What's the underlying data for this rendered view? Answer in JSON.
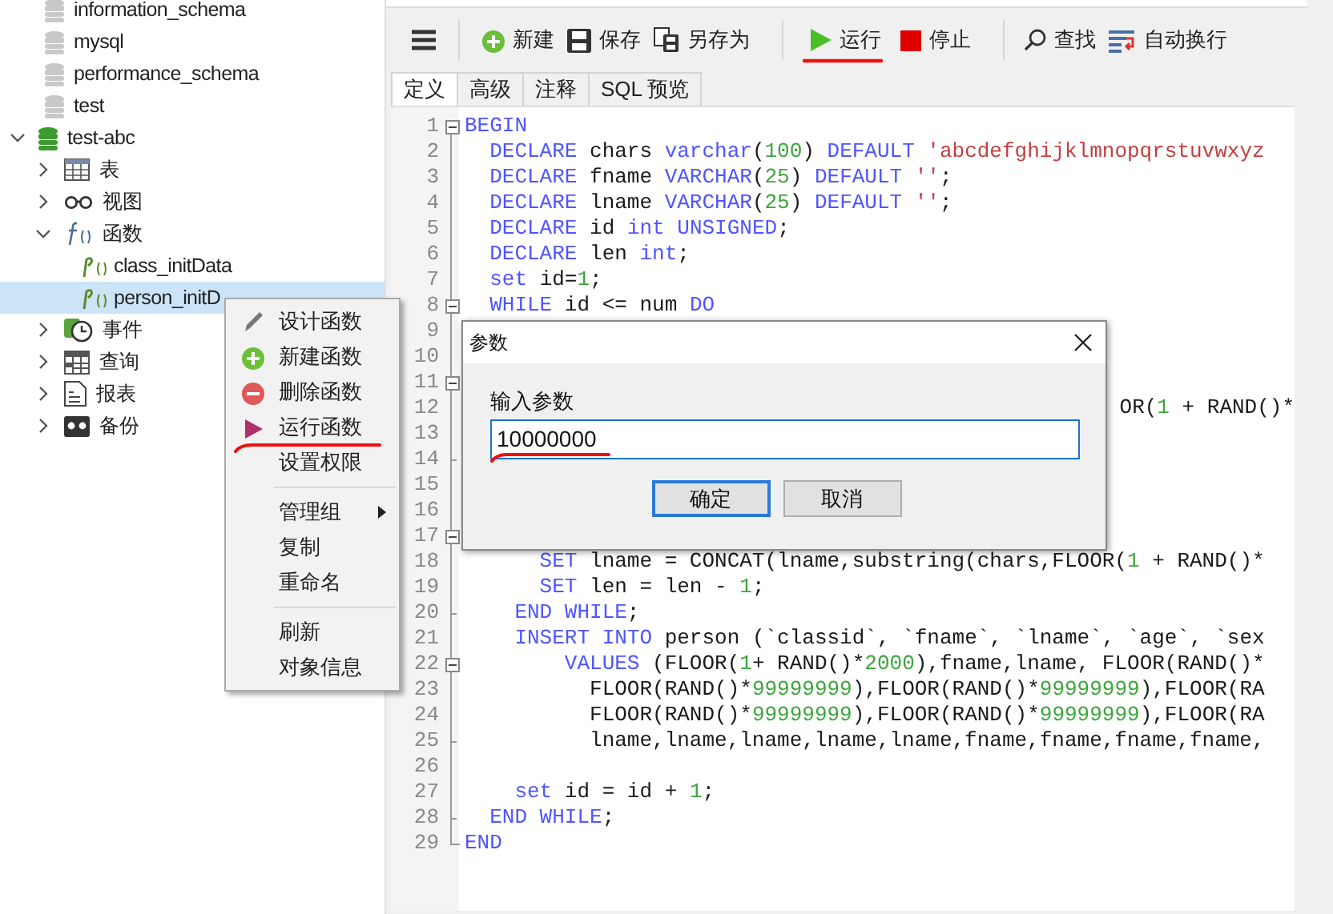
{
  "tree": [
    {
      "label": "information_schema",
      "kind": "db",
      "connected": false,
      "selected": false
    },
    {
      "label": "mysql",
      "kind": "db",
      "connected": false,
      "selected": false
    },
    {
      "label": "performance_schema",
      "kind": "db",
      "connected": false,
      "selected": false
    },
    {
      "label": "test",
      "kind": "db",
      "connected": false,
      "selected": false
    },
    {
      "label": "test-abc",
      "kind": "db",
      "connected": true,
      "expanded": true,
      "selected": false,
      "children": [
        {
          "label": "表",
          "kind": "tables",
          "expanded": false,
          "selected": false
        },
        {
          "label": "视图",
          "kind": "views",
          "expanded": false,
          "selected": false
        },
        {
          "label": "函数",
          "kind": "functions",
          "expanded": true,
          "selected": false,
          "children": [
            {
              "label": "class_initData",
              "kind": "function",
              "selected": false
            },
            {
              "label": "person_initD",
              "kind": "function",
              "selected": true
            }
          ]
        },
        {
          "label": "事件",
          "kind": "events",
          "expanded": false,
          "selected": false
        },
        {
          "label": "查询",
          "kind": "queries",
          "expanded": false,
          "selected": false
        },
        {
          "label": "报表",
          "kind": "reports",
          "expanded": false,
          "selected": false
        },
        {
          "label": "备份",
          "kind": "backups",
          "expanded": false,
          "selected": false
        }
      ]
    }
  ],
  "toolbar": [
    {
      "kind": "menu"
    },
    {
      "kind": "separator"
    },
    {
      "kind": "new",
      "label": "新建"
    },
    {
      "kind": "save",
      "label": "保存"
    },
    {
      "kind": "saveas",
      "label": "另存为"
    },
    {
      "kind": "separator"
    },
    {
      "kind": "run",
      "label": "运行",
      "highlighted": true
    },
    {
      "kind": "stop",
      "label": "停止"
    },
    {
      "kind": "separator"
    },
    {
      "kind": "find",
      "label": "查找"
    },
    {
      "kind": "wrap",
      "label": "自动换行"
    }
  ],
  "tabs": [
    {
      "label": "定义",
      "selected": true
    },
    {
      "label": "高级",
      "selected": false
    },
    {
      "label": "注释",
      "selected": false
    },
    {
      "label": "SQL 预览",
      "selected": false
    }
  ],
  "code_lines": [
    {
      "number": "1",
      "fold_start": true,
      "segments": [
        {
          "kind": "keyword",
          "text": "BEGIN"
        }
      ]
    },
    {
      "number": "2",
      "segments": [
        {
          "kind": "keyword",
          "text": "  DECLARE"
        },
        {
          "kind": "plain",
          "text": " chars "
        },
        {
          "kind": "keyword",
          "text": "varchar"
        },
        {
          "kind": "plain",
          "text": "("
        },
        {
          "kind": "number",
          "text": "100"
        },
        {
          "kind": "plain",
          "text": ") "
        },
        {
          "kind": "keyword",
          "text": "DEFAULT"
        },
        {
          "kind": "string",
          "text": " 'abcdefghijklmnopqrstuvwxyz"
        }
      ]
    },
    {
      "number": "3",
      "segments": [
        {
          "kind": "keyword",
          "text": "  DECLARE"
        },
        {
          "kind": "plain",
          "text": " fname "
        },
        {
          "kind": "keyword",
          "text": "VARCHAR"
        },
        {
          "kind": "plain",
          "text": "("
        },
        {
          "kind": "number",
          "text": "25"
        },
        {
          "kind": "plain",
          "text": ") "
        },
        {
          "kind": "keyword",
          "text": "DEFAULT"
        },
        {
          "kind": "string",
          "text": " ''"
        },
        {
          "kind": "plain",
          "text": ";"
        }
      ]
    },
    {
      "number": "4",
      "segments": [
        {
          "kind": "keyword",
          "text": "  DECLARE"
        },
        {
          "kind": "plain",
          "text": " lname "
        },
        {
          "kind": "keyword",
          "text": "VARCHAR"
        },
        {
          "kind": "plain",
          "text": "("
        },
        {
          "kind": "number",
          "text": "25"
        },
        {
          "kind": "plain",
          "text": ") "
        },
        {
          "kind": "keyword",
          "text": "DEFAULT"
        },
        {
          "kind": "string",
          "text": " ''"
        },
        {
          "kind": "plain",
          "text": ";"
        }
      ]
    },
    {
      "number": "5",
      "segments": [
        {
          "kind": "keyword",
          "text": "  DECLARE"
        },
        {
          "kind": "plain",
          "text": " id "
        },
        {
          "kind": "keyword",
          "text": "int UNSIGNED"
        },
        {
          "kind": "plain",
          "text": ";"
        }
      ]
    },
    {
      "number": "6",
      "segments": [
        {
          "kind": "keyword",
          "text": "  DECLARE"
        },
        {
          "kind": "plain",
          "text": " len "
        },
        {
          "kind": "keyword",
          "text": "int"
        },
        {
          "kind": "plain",
          "text": ";"
        }
      ]
    },
    {
      "number": "7",
      "segments": [
        {
          "kind": "keyword",
          "text": "  set"
        },
        {
          "kind": "plain",
          "text": " id="
        },
        {
          "kind": "number",
          "text": "1"
        },
        {
          "kind": "plain",
          "text": ";"
        }
      ]
    },
    {
      "number": "8",
      "fold_start": true,
      "segments": [
        {
          "kind": "keyword",
          "text": "  WHILE"
        },
        {
          "kind": "plain",
          "text": " id <= num "
        },
        {
          "kind": "keyword",
          "text": "DO"
        }
      ]
    },
    {
      "number": "9"
    },
    {
      "number": "10"
    },
    {
      "number": "11",
      "fold_start": true
    },
    {
      "number": "12",
      "cut_left": true,
      "segments": [
        {
          "kind": "plain",
          "text": "OR("
        },
        {
          "kind": "number",
          "text": "1"
        },
        {
          "kind": "plain",
          "text": " + RAND()*"
        }
      ]
    },
    {
      "number": "13"
    },
    {
      "number": "14",
      "fold_end": true
    },
    {
      "number": "15"
    },
    {
      "number": "16"
    },
    {
      "number": "17",
      "fold_start": true
    },
    {
      "number": "18",
      "segments": [
        {
          "kind": "keyword",
          "text": "      SET"
        },
        {
          "kind": "plain",
          "text": " lname = CONCAT(lname,substring(chars,FLOOR("
        },
        {
          "kind": "number",
          "text": "1"
        },
        {
          "kind": "plain",
          "text": " + RAND()*"
        }
      ]
    },
    {
      "number": "19",
      "segments": [
        {
          "kind": "keyword",
          "text": "      SET"
        },
        {
          "kind": "plain",
          "text": " len = len - "
        },
        {
          "kind": "number",
          "text": "1"
        },
        {
          "kind": "plain",
          "text": ";"
        }
      ]
    },
    {
      "number": "20",
      "fold_end": true,
      "segments": [
        {
          "kind": "keyword",
          "text": "    END WHILE"
        },
        {
          "kind": "plain",
          "text": ";"
        }
      ]
    },
    {
      "number": "21",
      "segments": [
        {
          "kind": "keyword",
          "text": "    INSERT INTO"
        },
        {
          "kind": "plain",
          "text": " person (`classid`, `fname`, `lname`, `age`, `sex"
        }
      ]
    },
    {
      "number": "22",
      "fold_start": true,
      "segments": [
        {
          "kind": "keyword",
          "text": "        VALUES"
        },
        {
          "kind": "plain",
          "text": " (FLOOR("
        },
        {
          "kind": "number",
          "text": "1"
        },
        {
          "kind": "plain",
          "text": "+ RAND()*"
        },
        {
          "kind": "number",
          "text": "2000"
        },
        {
          "kind": "plain",
          "text": "),fname,lname, FLOOR(RAND()*"
        }
      ]
    },
    {
      "number": "23",
      "segments": [
        {
          "kind": "plain",
          "text": "          FLOOR(RAND()*"
        },
        {
          "kind": "number",
          "text": "99999999"
        },
        {
          "kind": "plain",
          "text": "),FLOOR(RAND()*"
        },
        {
          "kind": "number",
          "text": "99999999"
        },
        {
          "kind": "plain",
          "text": "),FLOOR(RA"
        }
      ]
    },
    {
      "number": "24",
      "segments": [
        {
          "kind": "plain",
          "text": "          FLOOR(RAND()*"
        },
        {
          "kind": "number",
          "text": "99999999"
        },
        {
          "kind": "plain",
          "text": "),FLOOR(RAND()*"
        },
        {
          "kind": "number",
          "text": "99999999"
        },
        {
          "kind": "plain",
          "text": "),FLOOR(RA"
        }
      ]
    },
    {
      "number": "25",
      "fold_end": true,
      "segments": [
        {
          "kind": "plain",
          "text": "          lname,lname,lname,lname,lname,fname,fname,fname,fname,"
        }
      ]
    },
    {
      "number": "26"
    },
    {
      "number": "27",
      "segments": [
        {
          "kind": "keyword",
          "text": "    set"
        },
        {
          "kind": "plain",
          "text": " id = id + "
        },
        {
          "kind": "number",
          "text": "1"
        },
        {
          "kind": "plain",
          "text": ";"
        }
      ]
    },
    {
      "number": "28",
      "fold_end": true,
      "segments": [
        {
          "kind": "keyword",
          "text": "  END WHILE"
        },
        {
          "kind": "plain",
          "text": ";"
        }
      ]
    },
    {
      "number": "29",
      "fold_end": true,
      "segments": [
        {
          "kind": "keyword",
          "text": "END"
        }
      ]
    }
  ],
  "context_menu": [
    {
      "kind": "design",
      "label": "设计函数"
    },
    {
      "kind": "new",
      "label": "新建函数"
    },
    {
      "kind": "delete",
      "label": "删除函数"
    },
    {
      "kind": "run",
      "label": "运行函数",
      "highlighted": true
    },
    {
      "kind": "plain",
      "label": "设置权限"
    },
    {
      "kind": "separator"
    },
    {
      "kind": "plain",
      "label": "管理组",
      "submenu": true
    },
    {
      "kind": "plain",
      "label": "复制"
    },
    {
      "kind": "plain",
      "label": "重命名"
    },
    {
      "kind": "separator"
    },
    {
      "kind": "plain",
      "label": "刷新"
    },
    {
      "kind": "plain",
      "label": "对象信息"
    }
  ],
  "dialog": {
    "title": "参数",
    "field_label": "输入参数",
    "value": "10000000",
    "value_highlighted": true,
    "buttons": [
      {
        "label": "确定",
        "default": true
      },
      {
        "label": "取消",
        "default": false
      }
    ]
  }
}
